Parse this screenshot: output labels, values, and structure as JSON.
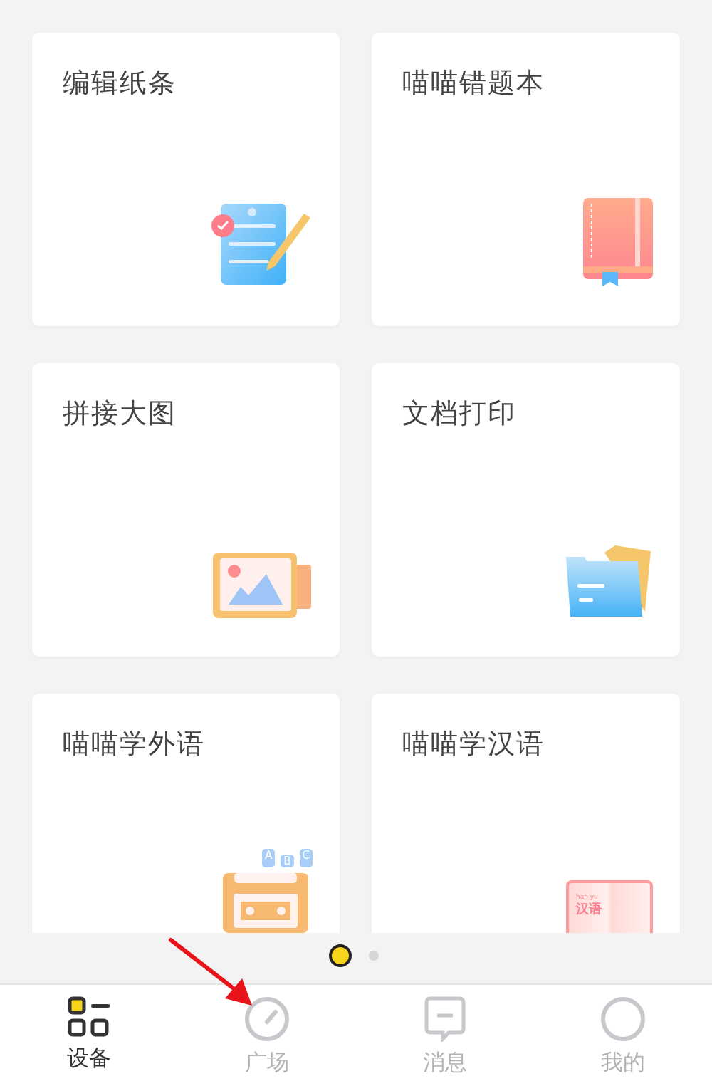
{
  "cards": [
    {
      "title": "编辑纸条",
      "kind": "note"
    },
    {
      "title": "喵喵错题本",
      "kind": "notebook"
    },
    {
      "title": "拼接大图",
      "kind": "photos"
    },
    {
      "title": "文档打印",
      "kind": "folder"
    },
    {
      "title": "喵喵学外语",
      "kind": "cassette",
      "icon_texts": [
        "A",
        "B",
        "C"
      ]
    },
    {
      "title": "喵喵学汉语",
      "kind": "book",
      "icon_texts": [
        "han yu",
        "汉语"
      ]
    }
  ],
  "pager": [
    {
      "selected": true
    },
    {
      "selected": false
    }
  ],
  "nav": [
    {
      "label": "设备",
      "kind": "devices",
      "selected": true
    },
    {
      "label": "广场",
      "kind": "plaza",
      "selected": false
    },
    {
      "label": "消息",
      "kind": "messages",
      "selected": false
    },
    {
      "label": "我的",
      "kind": "profile",
      "selected": false
    }
  ],
  "annotation": {
    "kind": "arrow"
  }
}
